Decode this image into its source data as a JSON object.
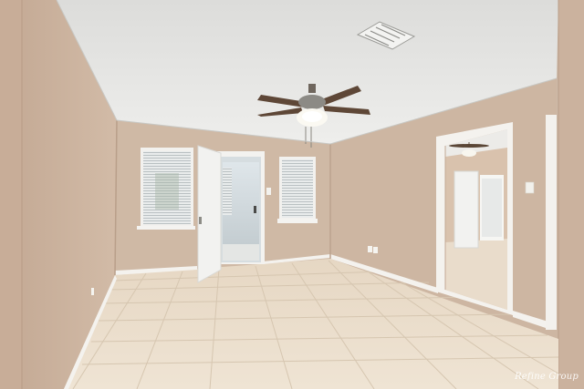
{
  "photo": {
    "scene": "empty-room-interior",
    "colors": {
      "wall": "#cdb6a2",
      "wall_shadow": "#bfa692",
      "ceiling": "#e6e6e4",
      "floor_tile": "#ece0cf",
      "grout": "#d8c9b4",
      "baseboard": "#f4f2ee",
      "door": "#f2f2f0"
    }
  },
  "watermark": {
    "text": "Refine Group"
  }
}
